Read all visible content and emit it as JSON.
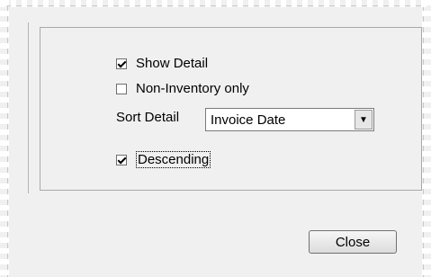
{
  "options": {
    "show_detail": {
      "label": "Show Detail",
      "checked": true
    },
    "non_inventory": {
      "label": "Non-Inventory only",
      "checked": false
    },
    "descending": {
      "label": "Descending",
      "checked": true
    }
  },
  "sort_detail": {
    "label": "Sort Detail",
    "selected": "Invoice Date"
  },
  "buttons": {
    "close_label": "Close"
  },
  "icons": {
    "dropdown": "chevron-down-icon"
  }
}
